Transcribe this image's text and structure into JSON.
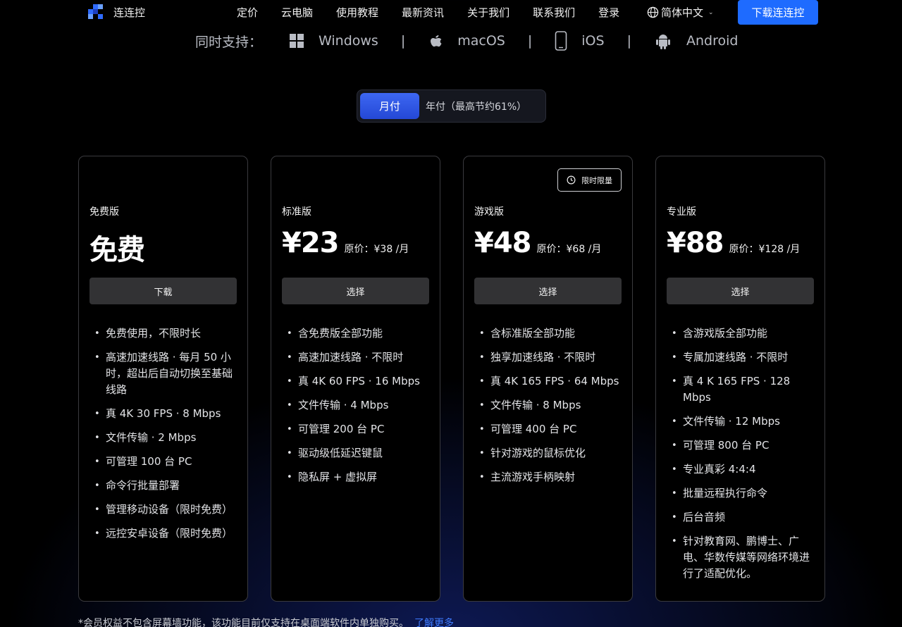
{
  "nav": {
    "brand": "连连控",
    "links": [
      "定价",
      "云电脑",
      "使用教程",
      "最新资讯",
      "关于我们",
      "联系我们",
      "登录"
    ],
    "language": "简体中文",
    "download_button": "下载连连控"
  },
  "platforms": {
    "label": "同时支持：",
    "items": [
      {
        "name": "Windows",
        "icon": "windows-icon"
      },
      {
        "name": "macOS",
        "icon": "apple-icon"
      },
      {
        "name": "iOS",
        "icon": "phone-icon"
      },
      {
        "name": "Android",
        "icon": "android-icon"
      }
    ],
    "separator": "|"
  },
  "billing_toggle": {
    "monthly": "月付",
    "yearly": "年付（最高节约61%）",
    "selected": "月付"
  },
  "plans": [
    {
      "name": "免费版",
      "price": "免费",
      "original": "",
      "button": "下载",
      "features": [
        "免费使用，不限时长",
        "高速加速线路 · 每月 50 小时，超出后自动切换至基础线路",
        "真 4K 30 FPS · 8 Mbps",
        "文件传输 · 2 Mbps",
        "可管理 100 台 PC",
        "命令行批量部署",
        "管理移动设备（限时免费）",
        "远控安卓设备（限时免费）"
      ]
    },
    {
      "name": "标准版",
      "price": "¥23",
      "original": "原价：¥38 /月",
      "button": "选择",
      "features": [
        "含免费版全部功能",
        "高速加速线路 · 不限时",
        "真 4K 60 FPS · 16 Mbps",
        "文件传输 · 4 Mbps",
        "可管理 200 台 PC",
        "驱动级低延迟键鼠",
        "隐私屏 + 虚拟屏"
      ]
    },
    {
      "name": "游戏版",
      "price": "¥48",
      "original": "原价：¥68 /月",
      "button": "选择",
      "badge": "限时限量",
      "features": [
        "含标准版全部功能",
        "独享加速线路 · 不限时",
        "真 4K 165 FPS · 64 Mbps",
        "文件传输 · 8 Mbps",
        "可管理 400 台 PC",
        "针对游戏的鼠标优化",
        "主流游戏手柄映射"
      ]
    },
    {
      "name": "专业版",
      "price": "¥88",
      "original": "原价：¥128 /月",
      "button": "选择",
      "features": [
        "含游戏版全部功能",
        "专属加速线路 · 不限时",
        "真 4 K 165 FPS · 128 Mbps",
        "文件传输 · 12 Mbps",
        "可管理 800 台 PC",
        "专业真彩 4:4:4",
        "批量远程执行命令",
        "后台音频",
        "针对教育网、鹏博士、广电、华数传媒等网络环境进行了适配优化。"
      ]
    }
  ],
  "footnote": {
    "text": "*会员权益不包含屏幕墙功能，该功能目前仅支持在桌面端软件内单独购买。",
    "link": "了解更多"
  },
  "colors": {
    "accent": "#1e6bff",
    "toggle_active": "#2f57e4",
    "card_border": "#3a3a3e",
    "button_bg": "#323234"
  }
}
